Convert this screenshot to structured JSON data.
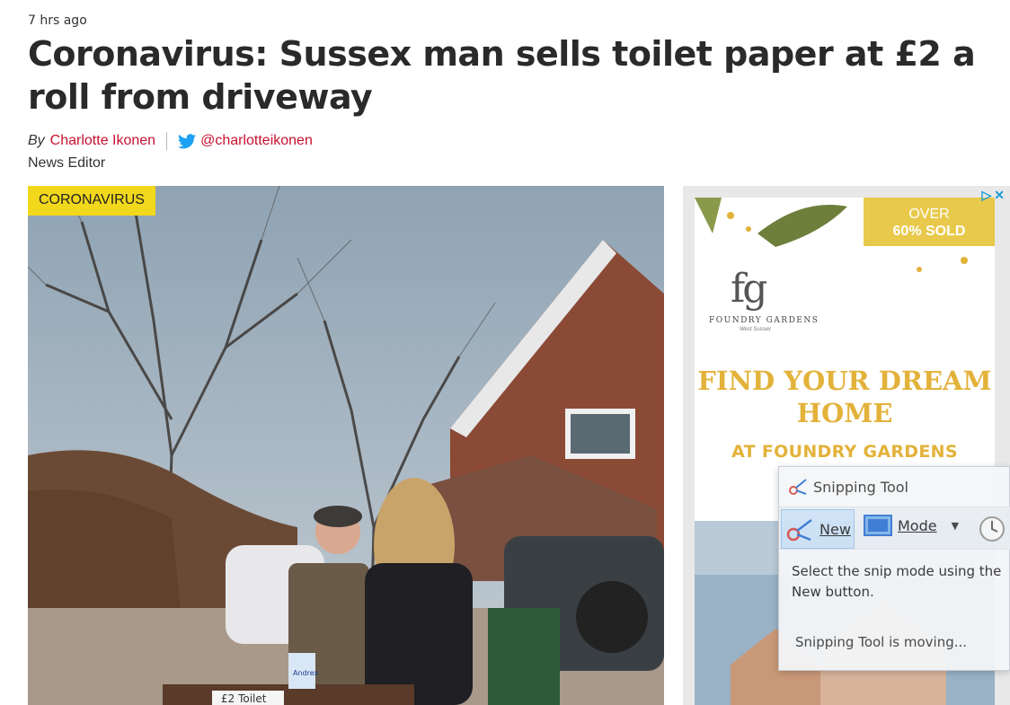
{
  "article": {
    "timestamp": "7 hrs ago",
    "headline": "Coronavirus: Sussex man sells toilet paper at £2 a roll from driveway",
    "byline_prefix": "By",
    "author": "Charlotte Ikonen",
    "twitter_handle": "@charlotteikonen",
    "role": "News Editor",
    "category_tag": "CORONAVIRUS",
    "image_sign_text": "£2 Toilet",
    "image_product_text": "Andrex"
  },
  "ad": {
    "badge_line1": "OVER",
    "badge_line2": "60% SOLD",
    "logo": "fg",
    "brand": "FOUNDRY GARDENS",
    "brand_sub": "West Sussex",
    "headline": "FIND YOUR DREAM HOME",
    "cta": "AT FOUNDRY GARDENS",
    "close_symbol": "✕",
    "choices_symbol": "▷"
  },
  "snipping_tool": {
    "title": "Snipping Tool",
    "new_label": "New",
    "mode_label": "Mode",
    "message": "Select the snip mode using the New button.",
    "status": "Snipping Tool is moving..."
  },
  "colors": {
    "link": "#c8102e",
    "tag_bg": "#f2d81c",
    "ad_gold": "#e3b23a",
    "twitter": "#1da1f2"
  }
}
